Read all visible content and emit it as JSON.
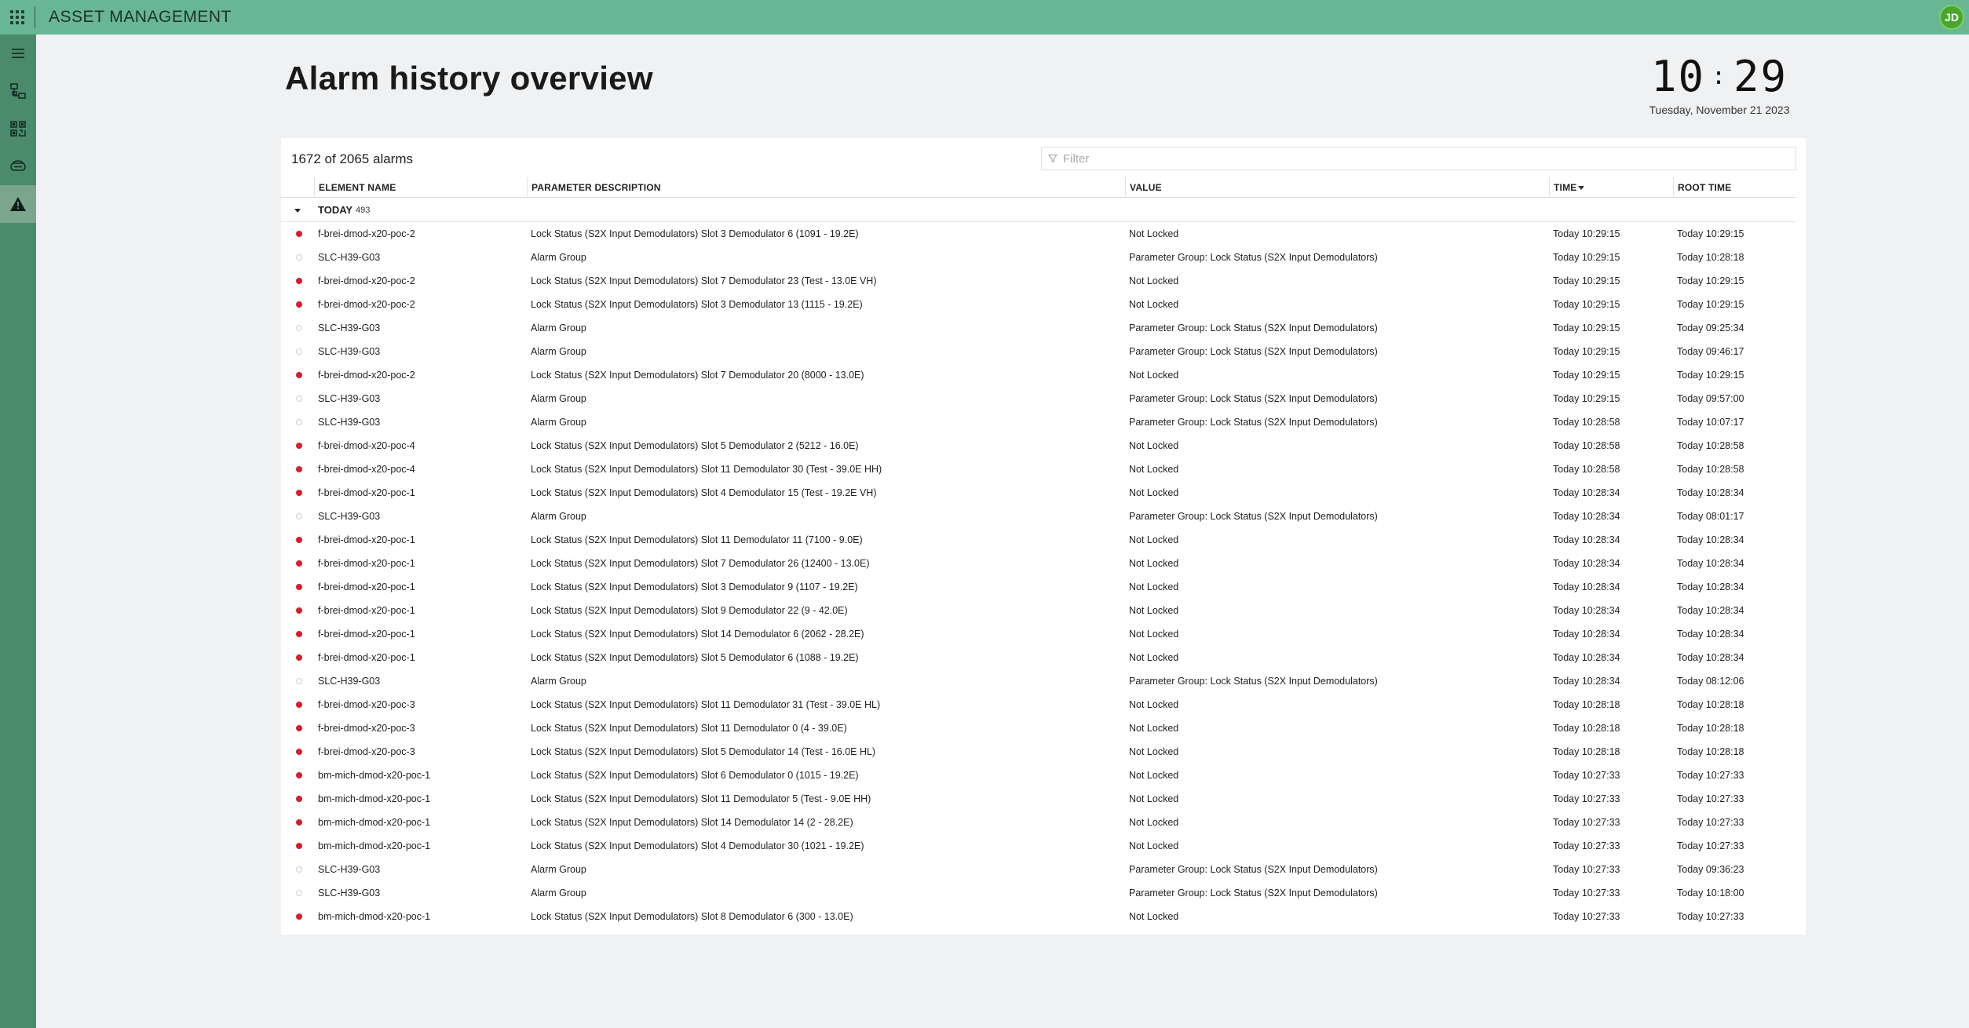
{
  "app": {
    "title": "ASSET MANAGEMENT",
    "user_initials": "JD"
  },
  "page": {
    "title": "Alarm history overview"
  },
  "clock": {
    "hours": "10",
    "minutes": "29",
    "date": "Tuesday, November 21 2023"
  },
  "alarms": {
    "count_label": "1672 of 2065 alarms",
    "filter_placeholder": "Filter",
    "columns": {
      "element": "ELEMENT NAME",
      "description": "PARAMETER DESCRIPTION",
      "value": "VALUE",
      "time": "TIME",
      "root_time": "ROOT TIME"
    },
    "group": {
      "label": "TODAY",
      "count": "493"
    },
    "rows": [
      {
        "severity": "critical",
        "element": "f-brei-dmod-x20-poc-2",
        "description": "Lock Status (S2X Input Demodulators) Slot 3 Demodulator 6 (1091 - 19.2E)",
        "value": "Not Locked",
        "time": "Today 10:29:15",
        "root_time": "Today 10:29:15"
      },
      {
        "severity": "normal",
        "element": "SLC-H39-G03",
        "description": "Alarm Group",
        "value": "Parameter Group: Lock Status (S2X Input Demodulators)",
        "time": "Today 10:29:15",
        "root_time": "Today 10:28:18"
      },
      {
        "severity": "critical",
        "element": "f-brei-dmod-x20-poc-2",
        "description": "Lock Status (S2X Input Demodulators) Slot 7 Demodulator 23 (Test - 13.0E VH)",
        "value": "Not Locked",
        "time": "Today 10:29:15",
        "root_time": "Today 10:29:15"
      },
      {
        "severity": "critical",
        "element": "f-brei-dmod-x20-poc-2",
        "description": "Lock Status (S2X Input Demodulators) Slot 3 Demodulator 13 (1115 - 19.2E)",
        "value": "Not Locked",
        "time": "Today 10:29:15",
        "root_time": "Today 10:29:15"
      },
      {
        "severity": "normal",
        "element": "SLC-H39-G03",
        "description": "Alarm Group",
        "value": "Parameter Group: Lock Status (S2X Input Demodulators)",
        "time": "Today 10:29:15",
        "root_time": "Today 09:25:34"
      },
      {
        "severity": "normal",
        "element": "SLC-H39-G03",
        "description": "Alarm Group",
        "value": "Parameter Group: Lock Status (S2X Input Demodulators)",
        "time": "Today 10:29:15",
        "root_time": "Today 09:46:17"
      },
      {
        "severity": "critical",
        "element": "f-brei-dmod-x20-poc-2",
        "description": "Lock Status (S2X Input Demodulators) Slot 7 Demodulator 20 (8000 - 13.0E)",
        "value": "Not Locked",
        "time": "Today 10:29:15",
        "root_time": "Today 10:29:15"
      },
      {
        "severity": "normal",
        "element": "SLC-H39-G03",
        "description": "Alarm Group",
        "value": "Parameter Group: Lock Status (S2X Input Demodulators)",
        "time": "Today 10:29:15",
        "root_time": "Today 09:57:00"
      },
      {
        "severity": "normal",
        "element": "SLC-H39-G03",
        "description": "Alarm Group",
        "value": "Parameter Group: Lock Status (S2X Input Demodulators)",
        "time": "Today 10:28:58",
        "root_time": "Today 10:07:17"
      },
      {
        "severity": "critical",
        "element": "f-brei-dmod-x20-poc-4",
        "description": "Lock Status (S2X Input Demodulators) Slot 5 Demodulator 2 (5212 - 16.0E)",
        "value": "Not Locked",
        "time": "Today 10:28:58",
        "root_time": "Today 10:28:58"
      },
      {
        "severity": "critical",
        "element": "f-brei-dmod-x20-poc-4",
        "description": "Lock Status (S2X Input Demodulators) Slot 11 Demodulator 30 (Test - 39.0E HH)",
        "value": "Not Locked",
        "time": "Today 10:28:58",
        "root_time": "Today 10:28:58"
      },
      {
        "severity": "critical",
        "element": "f-brei-dmod-x20-poc-1",
        "description": "Lock Status (S2X Input Demodulators) Slot 4 Demodulator 15 (Test - 19.2E VH)",
        "value": "Not Locked",
        "time": "Today 10:28:34",
        "root_time": "Today 10:28:34"
      },
      {
        "severity": "normal",
        "element": "SLC-H39-G03",
        "description": "Alarm Group",
        "value": "Parameter Group: Lock Status (S2X Input Demodulators)",
        "time": "Today 10:28:34",
        "root_time": "Today 08:01:17"
      },
      {
        "severity": "critical",
        "element": "f-brei-dmod-x20-poc-1",
        "description": "Lock Status (S2X Input Demodulators) Slot 11 Demodulator 11 (7100 - 9.0E)",
        "value": "Not Locked",
        "time": "Today 10:28:34",
        "root_time": "Today 10:28:34"
      },
      {
        "severity": "critical",
        "element": "f-brei-dmod-x20-poc-1",
        "description": "Lock Status (S2X Input Demodulators) Slot 7 Demodulator 26 (12400 - 13.0E)",
        "value": "Not Locked",
        "time": "Today 10:28:34",
        "root_time": "Today 10:28:34"
      },
      {
        "severity": "critical",
        "element": "f-brei-dmod-x20-poc-1",
        "description": "Lock Status (S2X Input Demodulators) Slot 3 Demodulator 9 (1107 - 19.2E)",
        "value": "Not Locked",
        "time": "Today 10:28:34",
        "root_time": "Today 10:28:34"
      },
      {
        "severity": "critical",
        "element": "f-brei-dmod-x20-poc-1",
        "description": "Lock Status (S2X Input Demodulators) Slot 9 Demodulator 22 (9 - 42.0E)",
        "value": "Not Locked",
        "time": "Today 10:28:34",
        "root_time": "Today 10:28:34"
      },
      {
        "severity": "critical",
        "element": "f-brei-dmod-x20-poc-1",
        "description": "Lock Status (S2X Input Demodulators) Slot 14 Demodulator 6 (2062 - 28.2E)",
        "value": "Not Locked",
        "time": "Today 10:28:34",
        "root_time": "Today 10:28:34"
      },
      {
        "severity": "critical",
        "element": "f-brei-dmod-x20-poc-1",
        "description": "Lock Status (S2X Input Demodulators) Slot 5 Demodulator 6 (1088 - 19.2E)",
        "value": "Not Locked",
        "time": "Today 10:28:34",
        "root_time": "Today 10:28:34"
      },
      {
        "severity": "normal",
        "element": "SLC-H39-G03",
        "description": "Alarm Group",
        "value": "Parameter Group: Lock Status (S2X Input Demodulators)",
        "time": "Today 10:28:34",
        "root_time": "Today 08:12:06"
      },
      {
        "severity": "critical",
        "element": "f-brei-dmod-x20-poc-3",
        "description": "Lock Status (S2X Input Demodulators) Slot 11 Demodulator 31 (Test - 39.0E HL)",
        "value": "Not Locked",
        "time": "Today 10:28:18",
        "root_time": "Today 10:28:18"
      },
      {
        "severity": "critical",
        "element": "f-brei-dmod-x20-poc-3",
        "description": "Lock Status (S2X Input Demodulators) Slot 11 Demodulator 0 (4 - 39.0E)",
        "value": "Not Locked",
        "time": "Today 10:28:18",
        "root_time": "Today 10:28:18"
      },
      {
        "severity": "critical",
        "element": "f-brei-dmod-x20-poc-3",
        "description": "Lock Status (S2X Input Demodulators) Slot 5 Demodulator 14 (Test - 16.0E HL)",
        "value": "Not Locked",
        "time": "Today 10:28:18",
        "root_time": "Today 10:28:18"
      },
      {
        "severity": "critical",
        "element": "bm-mich-dmod-x20-poc-1",
        "description": "Lock Status (S2X Input Demodulators) Slot 6 Demodulator 0 (1015 - 19.2E)",
        "value": "Not Locked",
        "time": "Today 10:27:33",
        "root_time": "Today 10:27:33"
      },
      {
        "severity": "critical",
        "element": "bm-mich-dmod-x20-poc-1",
        "description": "Lock Status (S2X Input Demodulators) Slot 11 Demodulator 5 (Test - 9.0E HH)",
        "value": "Not Locked",
        "time": "Today 10:27:33",
        "root_time": "Today 10:27:33"
      },
      {
        "severity": "critical",
        "element": "bm-mich-dmod-x20-poc-1",
        "description": "Lock Status (S2X Input Demodulators) Slot 14 Demodulator 14 (2 - 28.2E)",
        "value": "Not Locked",
        "time": "Today 10:27:33",
        "root_time": "Today 10:27:33"
      },
      {
        "severity": "critical",
        "element": "bm-mich-dmod-x20-poc-1",
        "description": "Lock Status (S2X Input Demodulators) Slot 4 Demodulator 30 (1021 - 19.2E)",
        "value": "Not Locked",
        "time": "Today 10:27:33",
        "root_time": "Today 10:27:33"
      },
      {
        "severity": "normal",
        "element": "SLC-H39-G03",
        "description": "Alarm Group",
        "value": "Parameter Group: Lock Status (S2X Input Demodulators)",
        "time": "Today 10:27:33",
        "root_time": "Today 09:36:23"
      },
      {
        "severity": "normal",
        "element": "SLC-H39-G03",
        "description": "Alarm Group",
        "value": "Parameter Group: Lock Status (S2X Input Demodulators)",
        "time": "Today 10:27:33",
        "root_time": "Today 10:18:00"
      },
      {
        "severity": "critical",
        "element": "bm-mich-dmod-x20-poc-1",
        "description": "Lock Status (S2X Input Demodulators) Slot 8 Demodulator 6 (300 - 13.0E)",
        "value": "Not Locked",
        "time": "Today 10:27:33",
        "root_time": "Today 10:27:33"
      }
    ]
  },
  "icons": {
    "apps": "apps-grid-icon",
    "menu": "hamburger-icon",
    "topology": "topology-icon",
    "dashboard": "qr-dashboard-icon",
    "devices": "device-icon",
    "alarms": "warning-icon",
    "filter": "filter-icon"
  },
  "colors": {
    "topbar": "#68b693",
    "sidebar": "#4b8a6b",
    "critical": "#d81e2b",
    "avatar": "#4aa52e"
  }
}
